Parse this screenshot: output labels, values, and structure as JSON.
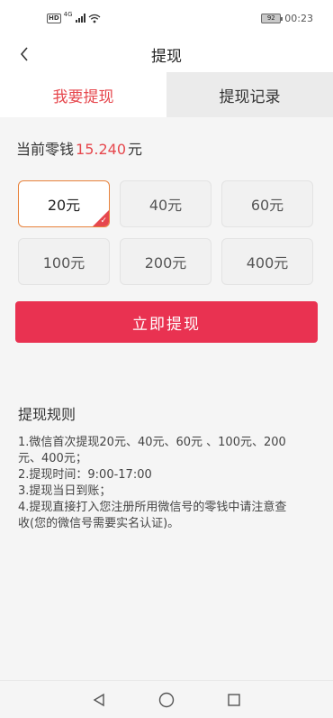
{
  "status_bar": {
    "sim_label": "HD",
    "network_label": "4G",
    "battery_level": "92",
    "time": "00:23"
  },
  "nav": {
    "back_glyph": "‹",
    "title": "提现"
  },
  "tabs": [
    {
      "label": "我要提现",
      "active": true
    },
    {
      "label": "提现记录",
      "active": false
    }
  ],
  "balance": {
    "prefix": "当前零钱",
    "amount": "15.240",
    "unit": "元"
  },
  "options": [
    {
      "label": "20元",
      "selected": true
    },
    {
      "label": "40元",
      "selected": false
    },
    {
      "label": "60元",
      "selected": false
    },
    {
      "label": "100元",
      "selected": false
    },
    {
      "label": "200元",
      "selected": false
    },
    {
      "label": "400元",
      "selected": false
    }
  ],
  "withdraw_button": "立即提现",
  "rules": {
    "title": "提现规则",
    "lines": [
      "1.微信首次提现20元、40元、60元 、100元、200",
      "元、400元；",
      "2.提现时间：9:00-17:00",
      "3.提现当日到账；",
      "4.提现直接打入您注册所用微信号的零钱中请注意查",
      "收(您的微信号需要实名认证)。"
    ]
  },
  "colors": {
    "accent": "#e6474d",
    "button": "#e93251",
    "selected_border": "#e8823b"
  },
  "icons": {
    "back": "chevron-left-icon",
    "sys_back": "triangle-back-icon",
    "sys_home": "circle-home-icon",
    "sys_recent": "square-recent-icon"
  }
}
